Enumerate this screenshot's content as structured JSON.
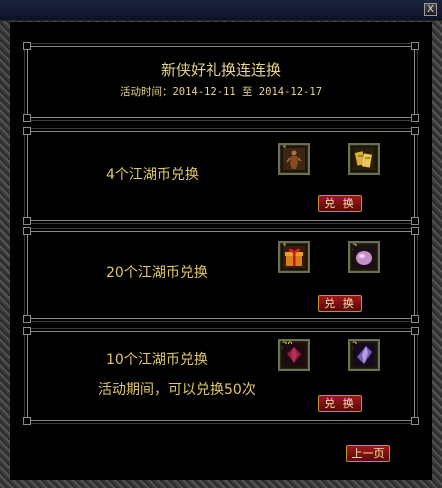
{
  "window": {
    "close_label": "X"
  },
  "header": {
    "title": "新侠好礼换连连换",
    "time_text": "活动时间：2014-12-11 至 2014-12-17"
  },
  "offers": [
    {
      "cost_text": "4个江湖币兑换",
      "items": [
        {
          "count": "1",
          "icon": "figure-statue-icon"
        },
        {
          "count": "",
          "icon": "gold-scrolls-icon"
        }
      ],
      "button_label": "兑 换"
    },
    {
      "cost_text": "20个江湖币兑换",
      "items": [
        {
          "count": "1",
          "icon": "gift-box-icon"
        },
        {
          "count": "3",
          "icon": "pink-gem-icon"
        }
      ],
      "button_label": "兑 换"
    },
    {
      "cost_text": "10个江湖币兑换",
      "note": "活动期间，可以兑换50次",
      "items": [
        {
          "count": "30",
          "icon": "red-jewel-icon"
        },
        {
          "count": "2",
          "icon": "purple-crystal-icon"
        }
      ],
      "button_label": "兑 换"
    }
  ],
  "footer": {
    "prev_page_label": "上一页"
  },
  "colors": {
    "text_gold": "#e0c86a",
    "button_red": "#a01818",
    "border_gray": "#8a8a8a"
  }
}
